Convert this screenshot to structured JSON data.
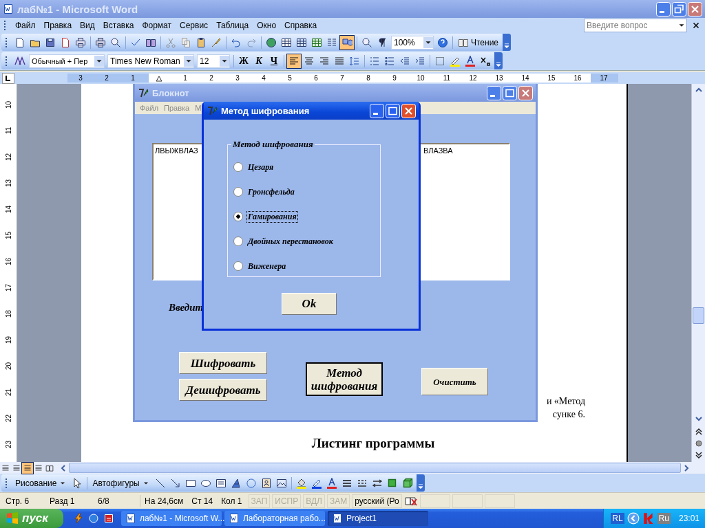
{
  "window": {
    "title": "лаб№1 - Microsoft Word"
  },
  "menu": [
    "Файл",
    "Правка",
    "Вид",
    "Вставка",
    "Формат",
    "Сервис",
    "Таблица",
    "Окно",
    "Справка"
  ],
  "help_search": {
    "placeholder": "Введите вопрос"
  },
  "standard_toolbar": {
    "zoom": "100%",
    "reading_button": "Чтение",
    "drawing_on": true
  },
  "formatting_toolbar": {
    "style": "Обычный + Пер",
    "font": "Times New Roman",
    "size": "12",
    "text_buttons": [
      "Ж",
      "К",
      "Ч"
    ],
    "alignment": [
      {
        "selected": true
      },
      {
        "selected": false
      },
      {
        "selected": false
      },
      {
        "selected": false
      }
    ]
  },
  "ruler": {
    "left_labels": [
      "3",
      "2",
      "1"
    ],
    "right_labels": [
      "1",
      "2",
      "3",
      "4",
      "5",
      "6",
      "7",
      "8",
      "9",
      "10",
      "11",
      "12",
      "13",
      "14",
      "15",
      "16",
      "17"
    ]
  },
  "vertical_ruler": {
    "labels": [
      "10",
      "11",
      "12",
      "13",
      "14",
      "15",
      "16",
      "17",
      "18",
      "19",
      "20",
      "21",
      "22",
      "23"
    ]
  },
  "document": {
    "lines": [
      "и «Метод",
      "сунке 6."
    ],
    "heading": "Листинг программы"
  },
  "notepad_window": {
    "title": "Блокнот",
    "menu": [
      "Файл",
      "Правка",
      "М"
    ],
    "text_left": "ЛВЫЖВЛАЗ",
    "text_right": "ВЛАЗВА",
    "prompt": "Введит",
    "buttons": [
      {
        "label": "Шифровать",
        "default": false
      },
      {
        "label": "Дешифровать",
        "default": false
      },
      {
        "label": "Метод шифрования",
        "default": true
      },
      {
        "label": "Очистить",
        "default": false
      }
    ]
  },
  "dialog": {
    "title": "Метод шифрования",
    "group_label": "Метод шифрования",
    "options": [
      {
        "label": "Цезаря",
        "selected": false
      },
      {
        "label": "Гронсфельда",
        "selected": false
      },
      {
        "label": "Гамирования",
        "selected": true
      },
      {
        "label": "Двойных перестановок",
        "selected": false
      },
      {
        "label": "Виженера",
        "selected": false
      }
    ],
    "ok_button": "Ok"
  },
  "drawing_toolbar": {
    "draw_menu": "Рисование",
    "autoshapes_menu": "Автофигуры"
  },
  "status_bar": {
    "fields": [
      "Стр. 6",
      "Разд 1",
      "6/8",
      "На 24,6см",
      "Ст 14",
      "Кол 1"
    ],
    "modes": [
      {
        "label": "ЗАП",
        "enabled": false
      },
      {
        "label": "ИСПР",
        "enabled": false
      },
      {
        "label": "ВДЛ",
        "enabled": false
      },
      {
        "label": "ЗАМ",
        "enabled": false
      }
    ],
    "language": "русский (Ро"
  },
  "taskbar": {
    "start": "пуск",
    "tasks": [
      {
        "label": "лаб№1 - Microsoft W...",
        "selected": false
      },
      {
        "label": "Лабораторная рабо...",
        "selected": false
      },
      {
        "label": "Project1",
        "selected": true
      }
    ],
    "keyboard": "RL",
    "language": "Ru",
    "clock": "23:01"
  }
}
